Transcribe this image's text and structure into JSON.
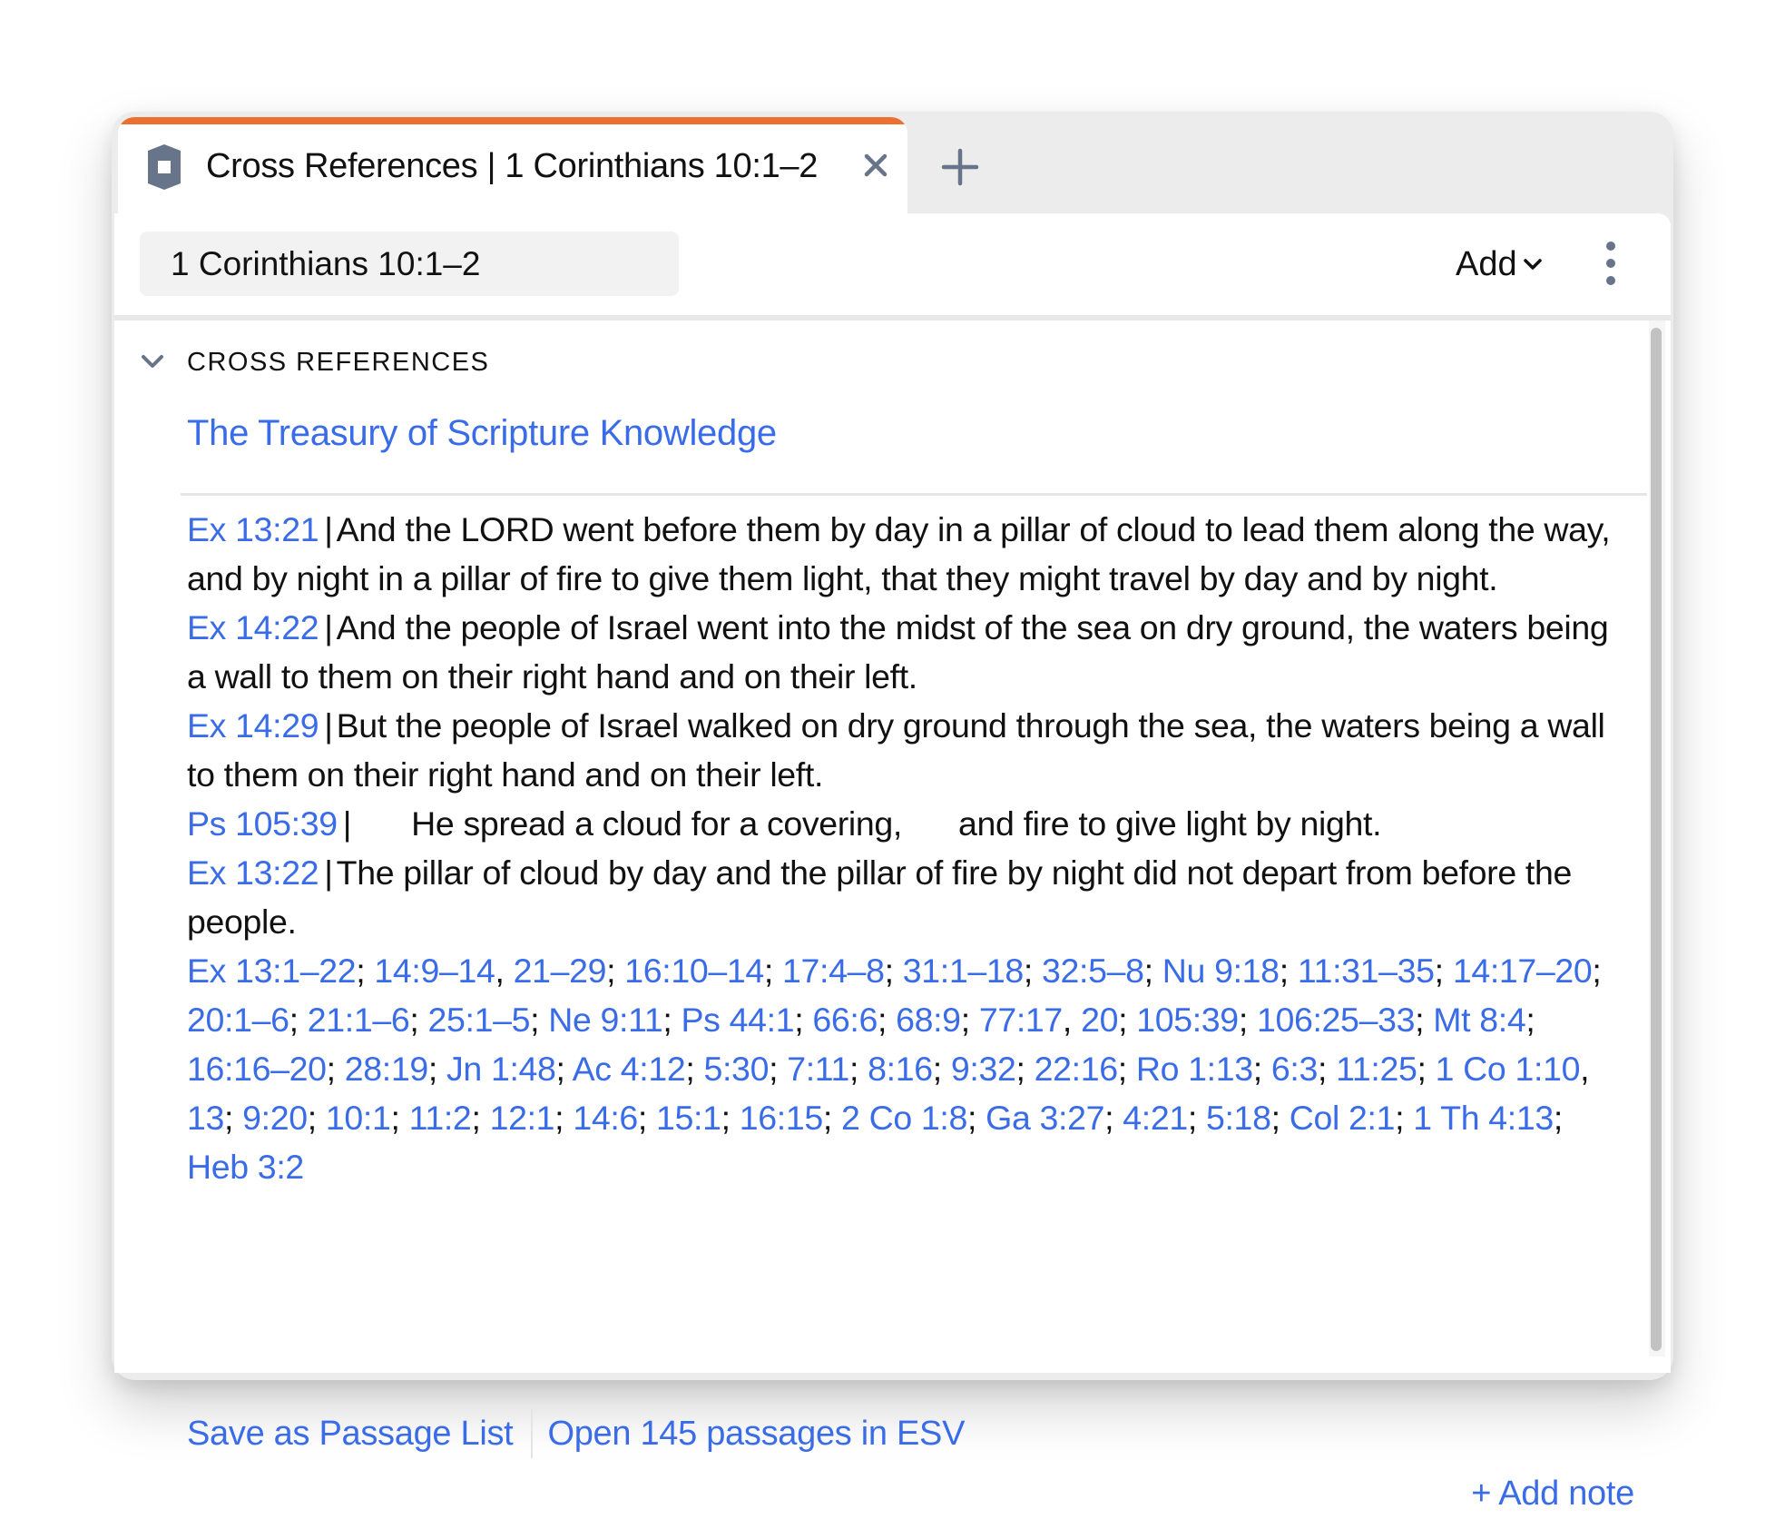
{
  "tab": {
    "title": "Cross References | 1 Corinthians 10:1–2",
    "icon": "resource-hexagon-icon",
    "close_icon": "close-icon",
    "new_tab_icon": "plus-icon",
    "accent_color": "#ec7032"
  },
  "toolbar": {
    "reference_value": "1 Corinthians 10:1–2",
    "add_label": "Add",
    "add_icon": "chevron-down-icon",
    "menu_icon": "kebab-menu-icon"
  },
  "section": {
    "title": "CROSS REFERENCES",
    "collapse_icon": "chevron-down-icon",
    "source": "The Treasury of Scripture Knowledge"
  },
  "verses": [
    {
      "ref": "Ex 13:21",
      "text": "And the LORD went before them by day in a pillar of cloud to lead them along the way, and by night in a pillar of fire to give them light, that they might travel by day and by night."
    },
    {
      "ref": "Ex 14:22",
      "text": "And the people of Israel went into the midst of the sea on dry ground, the waters being a wall to them on their right hand and on their left."
    },
    {
      "ref": "Ex 14:29",
      "text": "But the people of Israel walked on dry ground through the sea, the waters being a wall to them on their right hand and on their left."
    },
    {
      "ref": "Ps 105:39",
      "text_lines": [
        "He spread a cloud for a covering,",
        "and fire to give light by night."
      ]
    },
    {
      "ref": "Ex 13:22",
      "text": "The pillar of cloud by day and the pillar of fire by night did not depart from before the people."
    }
  ],
  "reference_list": [
    {
      "t": "Ex 13:1–22",
      "s": "; "
    },
    {
      "t": "14:9–14",
      "s": ", "
    },
    {
      "t": "21–29",
      "s": "; "
    },
    {
      "t": "16:10–14",
      "s": "; "
    },
    {
      "t": "17:4–8",
      "s": "; "
    },
    {
      "t": "31:1–18",
      "s": "; "
    },
    {
      "t": "32:5–8",
      "s": "; "
    },
    {
      "t": "Nu 9:18",
      "s": "; "
    },
    {
      "t": "11:31–35",
      "s": "; "
    },
    {
      "t": "14:17–20",
      "s": "; "
    },
    {
      "t": "20:1–6",
      "s": "; "
    },
    {
      "t": "21:1–6",
      "s": "; "
    },
    {
      "t": "25:1–5",
      "s": "; "
    },
    {
      "t": "Ne 9:11",
      "s": "; "
    },
    {
      "t": "Ps 44:1",
      "s": "; "
    },
    {
      "t": "66:6",
      "s": "; "
    },
    {
      "t": "68:9",
      "s": "; "
    },
    {
      "t": "77:17",
      "s": ", "
    },
    {
      "t": "20",
      "s": "; "
    },
    {
      "t": "105:39",
      "s": "; "
    },
    {
      "t": "106:25–33",
      "s": "; "
    },
    {
      "t": "Mt 8:4",
      "s": "; "
    },
    {
      "t": "16:16–20",
      "s": "; "
    },
    {
      "t": "28:19",
      "s": "; "
    },
    {
      "t": "Jn 1:48",
      "s": "; "
    },
    {
      "t": "Ac 4:12",
      "s": "; "
    },
    {
      "t": "5:30",
      "s": "; "
    },
    {
      "t": "7:11",
      "s": "; "
    },
    {
      "t": "8:16",
      "s": "; "
    },
    {
      "t": "9:32",
      "s": "; "
    },
    {
      "t": "22:16",
      "s": "; "
    },
    {
      "t": "Ro 1:13",
      "s": "; "
    },
    {
      "t": "6:3",
      "s": "; "
    },
    {
      "t": "11:25",
      "s": "; "
    },
    {
      "t": "1 Co 1:10",
      "s": ", "
    },
    {
      "t": "13",
      "s": "; "
    },
    {
      "t": "9:20",
      "s": "; "
    },
    {
      "t": "10:1",
      "s": "; "
    },
    {
      "t": "11:2",
      "s": "; "
    },
    {
      "t": "12:1",
      "s": "; "
    },
    {
      "t": "14:6",
      "s": "; "
    },
    {
      "t": "15:1",
      "s": "; "
    },
    {
      "t": "16:15",
      "s": "; "
    },
    {
      "t": "2 Co 1:8",
      "s": "; "
    },
    {
      "t": "Ga 3:27",
      "s": "; "
    },
    {
      "t": "4:21",
      "s": "; "
    },
    {
      "t": "5:18",
      "s": "; "
    },
    {
      "t": "Col 2:1",
      "s": "; "
    },
    {
      "t": "1 Th 4:13",
      "s": "; "
    },
    {
      "t": "Heb 3:2",
      "s": ""
    }
  ],
  "actions": {
    "save_label": "Save as Passage List",
    "open_label": "Open 145 passages in ESV",
    "add_note_label": "+ Add note"
  },
  "colors": {
    "link": "#3a6ce8",
    "icon_slate": "#677489",
    "window_frame": "#ececec"
  }
}
